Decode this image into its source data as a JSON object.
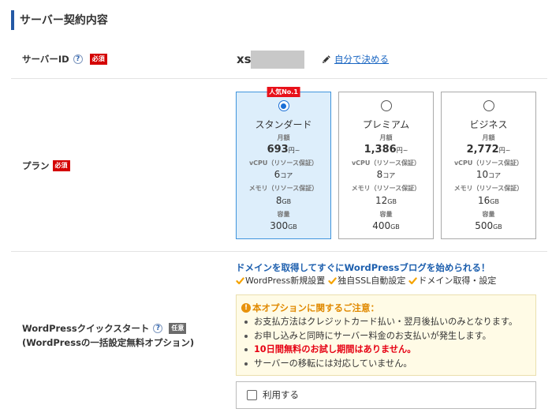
{
  "section": {
    "title": "サーバー契約内容"
  },
  "server_id": {
    "label": "サーバーID",
    "badge": "必須",
    "prefix": "xs",
    "edit_link": "自分で決める"
  },
  "plan": {
    "label": "プラン",
    "badge": "必須",
    "options": [
      {
        "name": "スタンダード",
        "badge": "人気No.1",
        "selected": true,
        "price_label": "月額",
        "price": "693",
        "price_unit": "円~",
        "cpu_label": "vCPU（リソース保証）",
        "cpu": "6",
        "cpu_unit": "コア",
        "memory_label": "メモリ（リソース保証）",
        "memory": "8",
        "memory_unit": "GB",
        "storage_label": "容量",
        "storage": "300",
        "storage_unit": "GB"
      },
      {
        "name": "プレミアム",
        "selected": false,
        "price_label": "月額",
        "price": "1,386",
        "price_unit": "円~",
        "cpu_label": "vCPU（リソース保証）",
        "cpu": "8",
        "cpu_unit": "コア",
        "memory_label": "メモリ（リソース保証）",
        "memory": "12",
        "memory_unit": "GB",
        "storage_label": "容量",
        "storage": "400",
        "storage_unit": "GB"
      },
      {
        "name": "ビジネス",
        "selected": false,
        "price_label": "月額",
        "price": "2,772",
        "price_unit": "円~",
        "cpu_label": "vCPU（リソース保証）",
        "cpu": "10",
        "cpu_unit": "コア",
        "memory_label": "メモリ（リソース保証）",
        "memory": "16",
        "memory_unit": "GB",
        "storage_label": "容量",
        "storage": "500",
        "storage_unit": "GB"
      }
    ]
  },
  "wp_quick_start": {
    "label": "WordPressクイックスタート",
    "badge": "任意",
    "sublabel": "(WordPressの一括設定無料オプション)",
    "headline": "ドメインを取得してすぐにWordPressブログを始められる！",
    "features": [
      "WordPress新規設置",
      "独自SSL自動設定",
      "ドメイン取得・設定"
    ],
    "notice": {
      "title": "本オプションに関するご注意：",
      "items": [
        {
          "text": "お支払方法はクレジットカード払い・翌月後払いのみとなります。",
          "emphasis": false
        },
        {
          "text": "お申し込みと同時にサーバー料金のお支払いが発生します。",
          "emphasis": false
        },
        {
          "text": "10日間無料のお試し期間はありません。",
          "emphasis": true
        },
        {
          "text": "サーバーの移転には対応していません。",
          "emphasis": false
        }
      ]
    },
    "checkbox": {
      "label": "利用する",
      "checked": false
    }
  },
  "icons": {
    "help": "help-icon",
    "edit": "pencil-icon",
    "plan_selector": "radio-icon",
    "feature_check": "check-icon",
    "notice": "alert-icon"
  },
  "colors": {
    "accent_blue": "#2459a5",
    "required_red": "#d40000",
    "optional_gray": "#6b6b6b",
    "link_blue": "#1a66c2",
    "headline_blue": "#1d5fae",
    "selected_bg": "#ddeefb",
    "selected_border": "#3f94dc",
    "radio_blue": "#1a6fd6",
    "popular_red": "#e8111a",
    "notice_bg": "#fffbe6",
    "notice_border": "#eadfae",
    "notice_title": "#e08900",
    "alert_orange": "#e8920b",
    "check_orange": "#f5a300",
    "emphasis_red": "#e60012"
  }
}
